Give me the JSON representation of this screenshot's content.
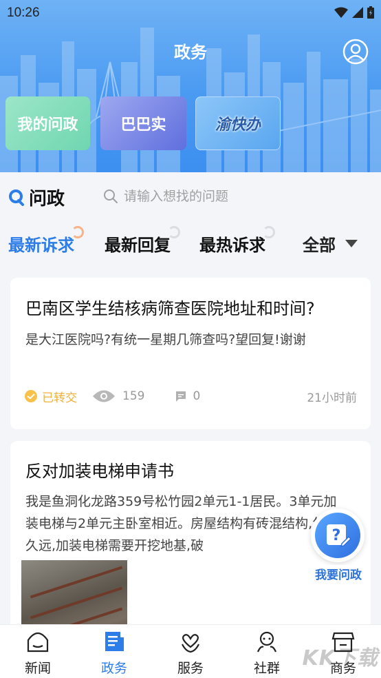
{
  "status_bar": {
    "time": "10:26"
  },
  "header": {
    "title": "政务",
    "quick_links": [
      {
        "label": "我的问政"
      },
      {
        "label": "巴巴实"
      },
      {
        "label": "渝快办"
      }
    ]
  },
  "search": {
    "brand": "问政",
    "placeholder": "请输入想找的问题"
  },
  "tabs": [
    {
      "label": "最新诉求",
      "active": true
    },
    {
      "label": "最新回复",
      "active": false
    },
    {
      "label": "最热诉求",
      "active": false
    }
  ],
  "filter": {
    "label": "全部"
  },
  "posts": [
    {
      "title": "巴南区学生结核病筛查医院地址和时间?",
      "body": "是大江医院吗?有统一星期几筛查吗?望回复!谢谢",
      "status": "已转交",
      "views": "159",
      "comments": "0",
      "time_ago": "21小时前"
    },
    {
      "title": "反对加装电梯申请书",
      "body": "我是鱼洞化龙路359号松竹园2单元1-1居民。3单元加装电梯与2单元主卧室相近。房屋结构有砖混结构,年代久远,加装电梯需要开挖地基,破"
    }
  ],
  "fab": {
    "label": "我要问政"
  },
  "bottom_nav": [
    {
      "label": "新闻",
      "icon": "news-icon",
      "active": false
    },
    {
      "label": "政务",
      "icon": "document-icon",
      "active": true
    },
    {
      "label": "服务",
      "icon": "heart-hands-icon",
      "active": false
    },
    {
      "label": "社群",
      "icon": "people-icon",
      "active": false
    },
    {
      "label": "商务",
      "icon": "shop-icon",
      "active": false
    }
  ],
  "watermark": "KK下载",
  "colors": {
    "primary": "#2d7de8",
    "header": "#4a9af2",
    "status": "#f0b03a"
  }
}
